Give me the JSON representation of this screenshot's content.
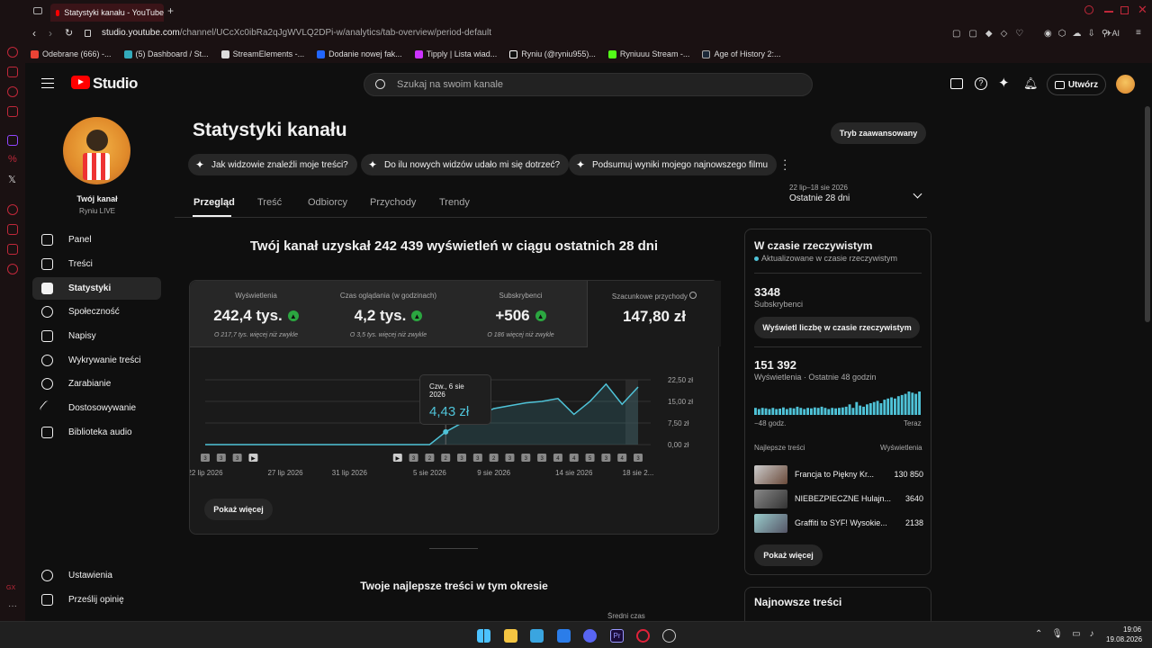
{
  "browser": {
    "tab_title": "Statystyki kanału - YouTube",
    "url_host": "studio.youtube.com",
    "url_path": "/channel/UCcXc0ibRa2qJgWVLQ2DPi-w/analytics/tab-overview/period-default",
    "bookmarks": [
      "Odebrane (666) -...",
      "(5) Dashboard / St...",
      "StreamElements -...",
      "Dodanie nowej fak...",
      "Tipply | Lista wiad...",
      "Ryniu (@ryniu955)...",
      "Ryniuuu Stream -...",
      "Age of History 2:..."
    ]
  },
  "header": {
    "logo_text": "Studio",
    "search_placeholder": "Szukaj na swoim kanale",
    "create_label": "Utwórz"
  },
  "sidebar": {
    "channel_label": "Twój kanał",
    "channel_name": "Ryniu LIVE",
    "items": [
      {
        "label": "Panel"
      },
      {
        "label": "Treści"
      },
      {
        "label": "Statystyki"
      },
      {
        "label": "Społeczność"
      },
      {
        "label": "Napisy"
      },
      {
        "label": "Wykrywanie treści"
      },
      {
        "label": "Zarabianie"
      },
      {
        "label": "Dostosowywanie"
      },
      {
        "label": "Biblioteka audio"
      }
    ],
    "bottom": [
      {
        "label": "Ustawienia"
      },
      {
        "label": "Prześlij opinię"
      }
    ]
  },
  "main": {
    "title": "Statystyki kanału",
    "advanced_button": "Tryb zaawansowany",
    "chips": [
      "Jak widzowie znaleźli moje treści?",
      "Do ilu nowych widzów udało mi się dotrzeć?",
      "Podsumuj wyniki mojego najnowszego filmu"
    ],
    "tabs": [
      "Przegląd",
      "Treść",
      "Odbiorcy",
      "Przychody",
      "Trendy"
    ],
    "date_range": "22 lip–18 sie 2026",
    "period": "Ostatnie 28 dni",
    "headline": "Twój kanał uzyskał 242 439 wyświetleń w ciągu ostatnich 28 dni",
    "metrics": [
      {
        "label": "Wyświetlenia",
        "value": "242,4 tys.",
        "sub": "O 217,7 tys. więcej niż zwykle"
      },
      {
        "label": "Czas oglądania (w godzinach)",
        "value": "4,2 tys.",
        "sub": "O 3,5 tys. więcej niż zwykle"
      },
      {
        "label": "Subskrybenci",
        "value": "+506",
        "sub": "O 186 więcej niż zwykle"
      },
      {
        "label": "Szacunkowe przychody",
        "value": "147,80 zł",
        "sub": ""
      }
    ],
    "tooltip": {
      "date": "Czw., 6 sie 2026",
      "value": "4,43 zł"
    },
    "show_more": "Pokaż więcej",
    "top_content_title": "Twoje najlepsze treści w tym okresie",
    "partial_col": "Średni czas"
  },
  "chart_data": {
    "type": "line",
    "title": "",
    "xlabel": "",
    "ylabel": "",
    "x_tick_labels": [
      "22 lip 2026",
      "27 lip 2026",
      "31 lip 2026",
      "5 sie 2026",
      "9 sie 2026",
      "14 sie 2026",
      "18 sie 2..."
    ],
    "y_tick_labels": [
      "22,50 zł",
      "15,00 zł",
      "7,50 zł",
      "0,00 zł"
    ],
    "ylim": [
      0,
      22.5
    ],
    "x": [
      "22 lip",
      "23 lip",
      "24 lip",
      "25 lip",
      "26 lip",
      "27 lip",
      "28 lip",
      "29 lip",
      "30 lip",
      "31 lip",
      "1 sie",
      "2 sie",
      "3 sie",
      "4 sie",
      "5 sie",
      "6 sie",
      "7 sie",
      "8 sie",
      "9 sie",
      "10 sie",
      "11 sie",
      "12 sie",
      "13 sie",
      "14 sie",
      "15 sie",
      "16 sie",
      "17 sie",
      "18 sie"
    ],
    "series": [
      {
        "values": [
          0,
          0,
          0,
          0,
          0,
          0,
          0,
          0,
          0,
          0,
          0,
          0,
          0,
          0,
          0,
          4.43,
          7.5,
          10,
          12.5,
          13.5,
          14.5,
          15,
          16,
          10.5,
          15,
          21,
          14,
          20
        ]
      }
    ],
    "markers": [
      "3",
      "3",
      "3",
      "▶",
      "",
      "",
      "",
      "",
      "",
      "",
      "",
      "",
      "▶",
      "3",
      "2",
      "2",
      "3",
      "3",
      "2",
      "3",
      "3",
      "3",
      "4",
      "4",
      "5",
      "3",
      "4",
      "3"
    ],
    "grid": true
  },
  "realtime": {
    "title": "W czasie rzeczywistym",
    "updated": "Aktualizowane w czasie rzeczywistym",
    "subs_value": "3348",
    "subs_label": "Subskrybenci",
    "subs_button": "Wyświetl liczbę w czasie rzeczywistym",
    "views_value": "151 392",
    "views_label": "Wyświetlenia · Ostatnie 48 godzin",
    "axis_left": "−48 godz.",
    "axis_right": "Teraz",
    "top_label": "Najlepsze treści",
    "views_col": "Wyświetlenia",
    "items": [
      {
        "title": "Francja to Piękny Kr...",
        "views": "130 850"
      },
      {
        "title": "NIEBEZPIECZNE Hulajn...",
        "views": "3640"
      },
      {
        "title": "Graffiti to SYF! Wysokie...",
        "views": "2138"
      }
    ],
    "show_more": "Pokaż więcej",
    "newest_title": "Najnowsze treści",
    "bars": [
      0.3,
      0.25,
      0.3,
      0.28,
      0.25,
      0.3,
      0.25,
      0.27,
      0.32,
      0.25,
      0.3,
      0.28,
      0.35,
      0.3,
      0.25,
      0.3,
      0.28,
      0.32,
      0.3,
      0.35,
      0.3,
      0.25,
      0.3,
      0.28,
      0.3,
      0.32,
      0.35,
      0.45,
      0.3,
      0.55,
      0.4,
      0.35,
      0.45,
      0.5,
      0.55,
      0.6,
      0.5,
      0.65,
      0.7,
      0.75,
      0.7,
      0.8,
      0.85,
      0.9,
      1.0,
      0.95,
      0.9,
      1.0
    ]
  },
  "taskbar": {
    "time": "19:06",
    "date": "19.08.2026"
  }
}
